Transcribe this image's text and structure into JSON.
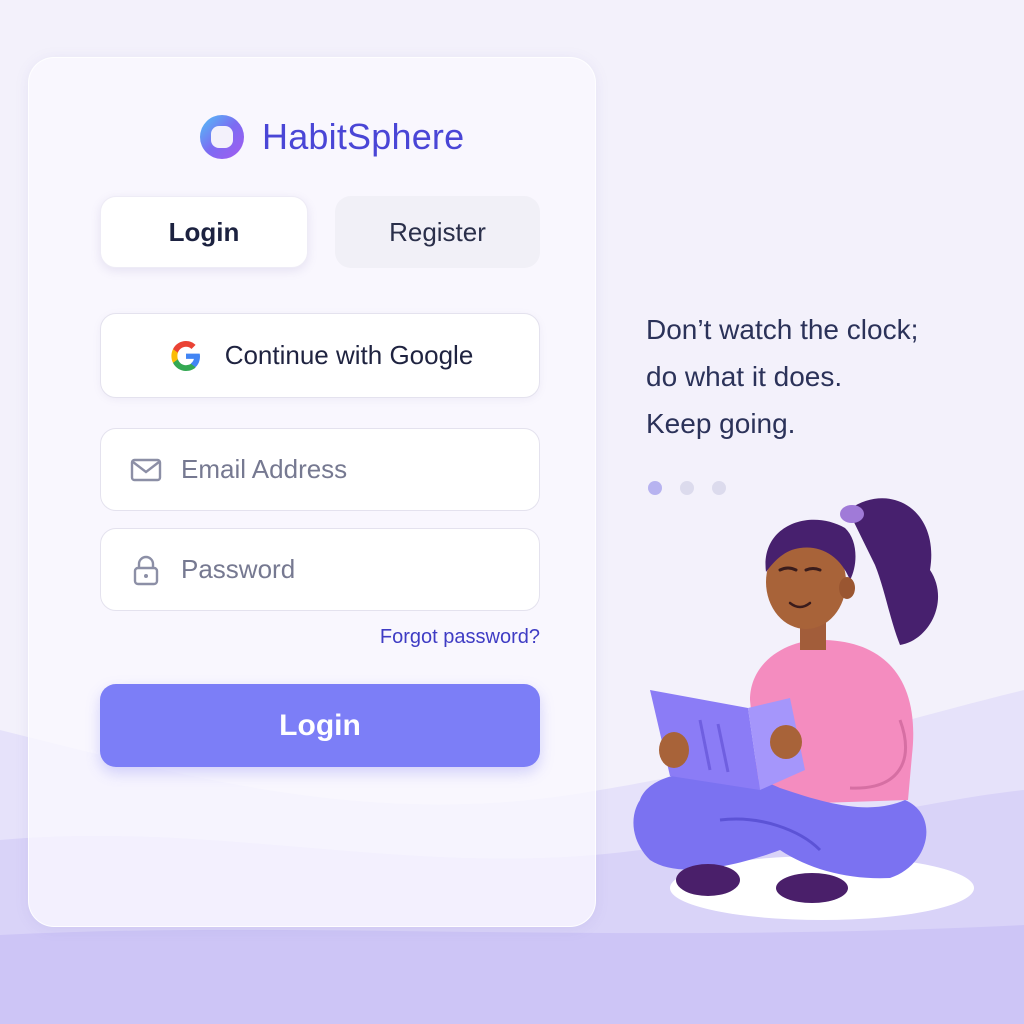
{
  "brand": {
    "name": "HabitSphere"
  },
  "tabs": {
    "login": "Login",
    "register": "Register"
  },
  "form": {
    "google_label": "Continue with Google",
    "email_placeholder": "Email Address",
    "password_placeholder": "Password",
    "forgot_link": "Forgot password?",
    "submit_label": "Login"
  },
  "quote": {
    "line1": "Don’t watch the clock;",
    "line2": "do what it does.",
    "line3": "Keep going."
  },
  "carousel": {
    "total": 3,
    "active": 1
  },
  "colors": {
    "accent": "#7c7ef7",
    "brand": "#4a46d6",
    "link": "#3f3cc4"
  },
  "icons": {
    "google": "google-icon",
    "email": "mail-icon",
    "password": "lock-icon"
  }
}
